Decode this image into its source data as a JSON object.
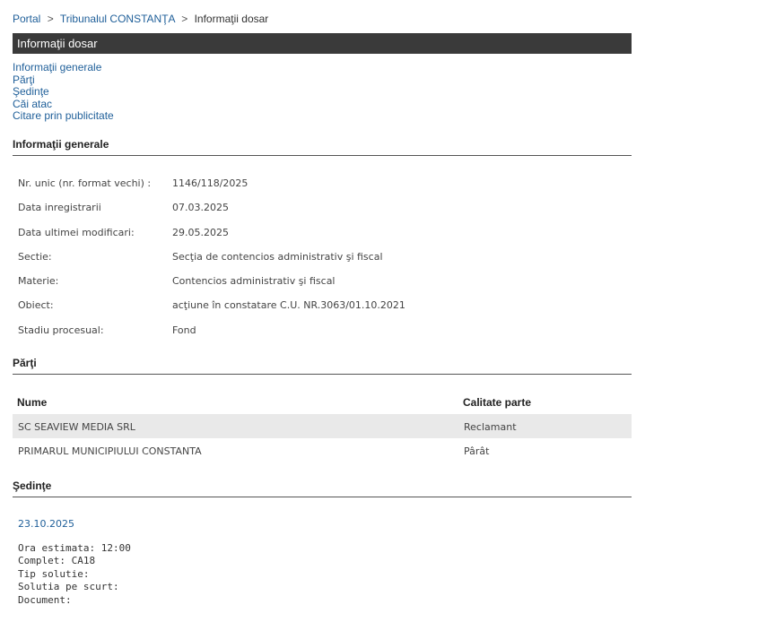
{
  "breadcrumb": {
    "items": [
      "Portal",
      "Tribunalul CONSTANŢA",
      "Informaţii dosar"
    ],
    "separator": ">"
  },
  "page_title": "Informaţii dosar",
  "anchors": [
    "Informaţii generale",
    "Părţi",
    "Şedinţe",
    "Căi atac",
    "Citare prin publicitate"
  ],
  "general": {
    "heading": "Informaţii generale",
    "rows": [
      {
        "label": "Nr. unic (nr. format vechi) :",
        "value": "1146/118/2025"
      },
      {
        "label": "Data inregistrarii",
        "value": "07.03.2025"
      },
      {
        "label": "Data ultimei modificari:",
        "value": "29.05.2025"
      },
      {
        "label": "Sectie:",
        "value": "Secţia de contencios administrativ şi fiscal"
      },
      {
        "label": "Materie:",
        "value": "Contencios administrativ şi fiscal"
      },
      {
        "label": "Obiect:",
        "value": "acţiune în constatare C.U. NR.3063/01.10.2021"
      },
      {
        "label": "Stadiu procesual:",
        "value": "Fond"
      }
    ]
  },
  "parti": {
    "heading": "Părţi",
    "columns": [
      "Nume",
      "Calitate parte"
    ],
    "rows": [
      {
        "name": "SC SEAVIEW MEDIA SRL",
        "role": "Reclamant"
      },
      {
        "name": "PRIMARUL MUNICIPIULUI CONSTANTA",
        "role": "Pârât"
      }
    ]
  },
  "sedinte": {
    "heading": "Şedinţe",
    "items": [
      {
        "date": "23.10.2025",
        "details": [
          "Ora estimata: 12:00",
          "Complet: CA18",
          "Tip solutie:",
          "Solutia pe scurt:",
          "Document:"
        ]
      }
    ]
  },
  "colors": {
    "link": "#1f5f99",
    "title_bar": "#3a3a3a",
    "alt_row": "#e9e9e9"
  }
}
